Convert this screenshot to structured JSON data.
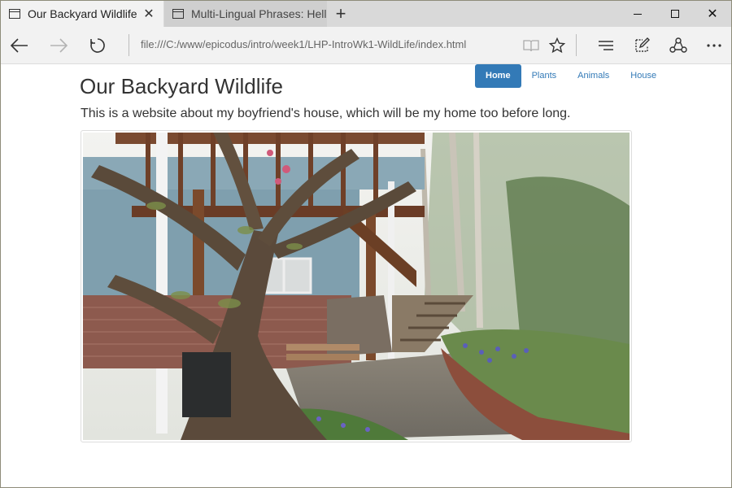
{
  "browser": {
    "tabs": [
      {
        "title": "Our Backyard Wildlife",
        "active": true
      },
      {
        "title": "Multi-Lingual Phrases: Hellc",
        "active": false
      }
    ],
    "new_tab_icon": "plus-icon",
    "address": "file:///C:/www/epicodus/intro/week1/LHP-IntroWk1-WildLife/index.html",
    "icons": {
      "back": "back-arrow-icon",
      "forward": "forward-arrow-icon",
      "refresh": "refresh-icon",
      "reading_view": "book-icon",
      "favorite": "star-icon",
      "hub": "hub-icon",
      "web_note": "pen-note-icon",
      "share": "share-icon",
      "more": "more-icon"
    }
  },
  "page": {
    "title": "Our Backyard Wildlife",
    "tagline": "This is a website about my boyfriend's house, which will be my home too before long.",
    "nav": [
      {
        "label": "Home",
        "active": true
      },
      {
        "label": "Plants",
        "active": false
      },
      {
        "label": "Animals",
        "active": false
      },
      {
        "label": "House",
        "active": false
      }
    ]
  },
  "colors": {
    "nav_accent": "#337ab7",
    "tabbar": "#d9d9d9",
    "toolbar": "#f2f2f2"
  }
}
